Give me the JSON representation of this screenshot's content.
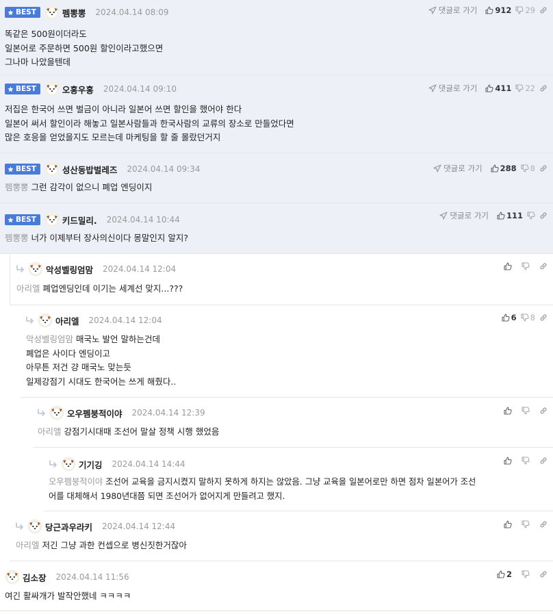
{
  "ui": {
    "best_label": "BEST",
    "reply_label": "댓글로 가기"
  },
  "comments": [
    {
      "nick": "펨뽕뽕",
      "date": "2024.04.14 08:09",
      "likes": "912",
      "dislikes": "29",
      "lines": [
        "똑같은 500원이더라도",
        "일본어로 주문하면 500원 할인이라고했으면",
        "그나마 나았을텐데"
      ]
    },
    {
      "nick": "오홍우홍",
      "date": "2024.04.14 09:10",
      "likes": "411",
      "dislikes": "22",
      "lines": [
        "저집은 한국어 쓰면 벌금이 아니라 일본어 쓰면 할인을 했어야 한다",
        "일본어 써서 할인이라 해놓고 일본사람들과 한국사람의 교류의 장소로 만들었다면",
        "많은 호응을 얻었을지도 모르는데 마케팅을 할 줄 몰랐던거지"
      ]
    },
    {
      "nick": "성산동밥벌레즈",
      "date": "2024.04.14 09:34",
      "likes": "288",
      "dislikes": "8",
      "mention": "펨뽕뽕",
      "text": "그런 감각이 없으니 폐업 엔딩이지"
    },
    {
      "nick": "키드밀리.",
      "date": "2024.04.14 10:44",
      "likes": "111",
      "mention": "펨뽕뽕",
      "text": "너가 이제부터 장사의신이다 몽말인지 알지?"
    },
    {
      "nick": "악성벨링엄맘",
      "date": "2024.04.14 12:04",
      "mention": "아리엘",
      "text": "폐업엔딩인데 이기는 세계선 맞지...???"
    },
    {
      "nick": "아리엘",
      "date": "2024.04.14 12:04",
      "likes": "6",
      "dislikes": "8",
      "mention": "악성벨링엄맘",
      "text": "매국노 발언 말하는건데",
      "lines": [
        "폐업은 사이다 엔딩이고",
        "아무튼 저건 걍 매국노 맞는듯",
        "일제강점기 시대도 한국어는 쓰게 해줬다.."
      ]
    },
    {
      "nick": "오우펨붕적이야",
      "date": "2024.04.14 12:39",
      "mention": "아리엘",
      "text": "강점기시대때 조선어 말살 정책 시행 했었음"
    },
    {
      "nick": "기기깅",
      "date": "2024.04.14 14:44",
      "mention": "오우펨붕적이야",
      "text": "조선어 교육을 금지시켰지 말하지 못하게 하지는 않았음. 그냥 교육을 일본어로만 하면 점차 일본어가 조선",
      "line2": "어를 대체해서 1980년대쯤 되면 조선어가 없어지게 만들려고 했지."
    },
    {
      "nick": "당근과우라키",
      "date": "2024.04.14 12:44",
      "mention": "아리엘",
      "text": "저긴 그냥 과한 컨셉으로 병신짓한거잖아"
    },
    {
      "nick": "김소장",
      "date": "2024.04.14 11:56",
      "likes": "2",
      "text": "여긴 활싸개가 발작안했네 ㅋㅋㅋㅋ"
    }
  ],
  "colors": {
    "accent": "#4a7bd6",
    "best_bg": "#eef0f8",
    "muted": "#9a9a9a"
  },
  "icons": [
    "star-icon",
    "paper-plane-icon",
    "thumb-up-icon",
    "thumb-down-icon",
    "link-icon",
    "reply-arrow-icon",
    "dog-avatar-icon"
  ]
}
